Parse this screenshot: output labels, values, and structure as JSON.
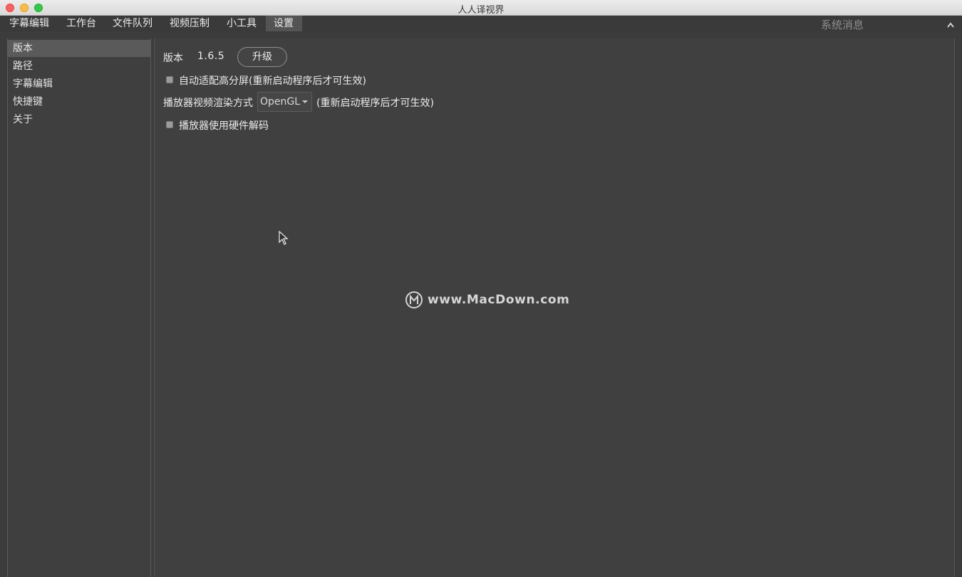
{
  "window": {
    "title": "人人译视界"
  },
  "tabs": [
    {
      "label": "字幕编辑"
    },
    {
      "label": "工作台"
    },
    {
      "label": "文件队列"
    },
    {
      "label": "视频压制"
    },
    {
      "label": "小工具"
    },
    {
      "label": "设置",
      "active": true
    }
  ],
  "system_messages": "系统消息",
  "sidebar": {
    "items": [
      {
        "label": "版本",
        "selected": true
      },
      {
        "label": "路径"
      },
      {
        "label": "字幕编辑"
      },
      {
        "label": "快捷键"
      },
      {
        "label": "关于"
      }
    ]
  },
  "version": {
    "label": "版本",
    "value": "1.6.5",
    "upgrade_label": "升级"
  },
  "settings": {
    "hidpi": {
      "label": "自动适配高分屏(重新启动程序后才可生效)",
      "checked": false
    },
    "render": {
      "label": "播放器视频渲染方式",
      "selected": "OpenGL",
      "note": "(重新启动程序后才可生效)"
    },
    "hw_decode": {
      "label": "播放器使用硬件解码",
      "checked": false
    }
  },
  "watermark": {
    "text": "www.MacDown.com"
  },
  "icons": {
    "collapse": "chevron-up-icon",
    "watermark_logo": "macdown-logo-icon",
    "cursor": "mouse-pointer-icon"
  },
  "colors": {
    "background": "#3c3c3c",
    "panel": "#404040",
    "selected": "#5a5a5a",
    "close": "#fc605c",
    "minimize": "#fdbc40",
    "maximize": "#34c84a"
  }
}
